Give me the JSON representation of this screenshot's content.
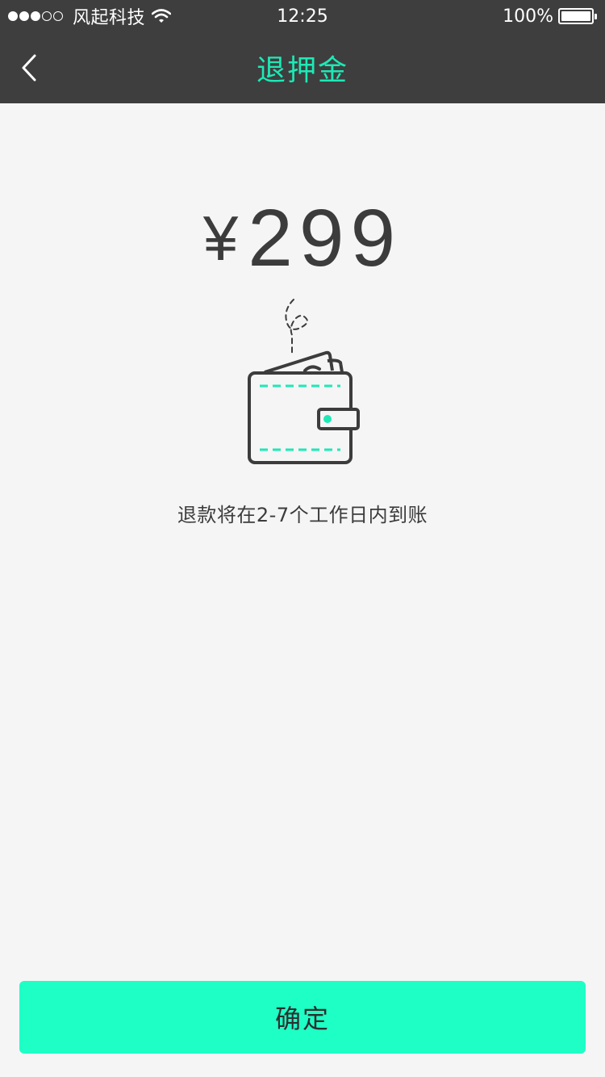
{
  "status_bar": {
    "carrier": "风起科技",
    "time": "12:25",
    "battery": "100%",
    "battery_level": 1.0,
    "signal_strength": 3,
    "signal_max": 5
  },
  "nav": {
    "title": "退押金",
    "back_icon": "chevron-left-icon"
  },
  "main": {
    "currency_symbol": "¥",
    "amount": "299",
    "wallet_icon": "wallet-icon",
    "note": "退款将在2-7个工作日内到账"
  },
  "footer": {
    "confirm_label": "确定"
  },
  "colors": {
    "accent": "#1de9b6",
    "button": "#1effc6",
    "bar": "#3e3e3e",
    "background": "#f5f5f5",
    "text": "#3c3c3c"
  }
}
